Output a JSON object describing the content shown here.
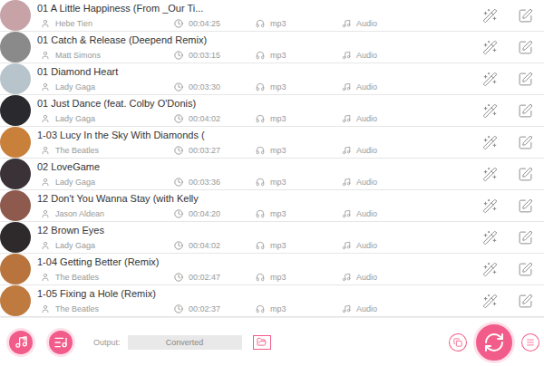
{
  "tracks": [
    {
      "title": "01 A Little Happiness (From _Our Ti...",
      "artist": "Hebe Tien",
      "duration": "00:04:25",
      "format": "mp3",
      "type": "Audio",
      "color": "#c7a3a8"
    },
    {
      "title": "01 Catch & Release (Deepend Remix)",
      "artist": "Matt Simons",
      "duration": "00:03:15",
      "format": "mp3",
      "type": "Audio",
      "color": "#8a8a8a"
    },
    {
      "title": "01 Diamond Heart",
      "artist": "Lady Gaga",
      "duration": "00:03:30",
      "format": "mp3",
      "type": "Audio",
      "color": "#b8c4cc"
    },
    {
      "title": "01 Just Dance (feat. Colby O'Donis)",
      "artist": "Lady Gaga",
      "duration": "00:04:02",
      "format": "mp3",
      "type": "Audio",
      "color": "#2a2a2e"
    },
    {
      "title": "1-03 Lucy In the Sky With Diamonds (",
      "artist": "The Beatles",
      "duration": "00:03:27",
      "format": "mp3",
      "type": "Audio",
      "color": "#c8803a"
    },
    {
      "title": "02 LoveGame",
      "artist": "Lady Gaga",
      "duration": "00:03:36",
      "format": "mp3",
      "type": "Audio",
      "color": "#3a3236"
    },
    {
      "title": "12 Don't You Wanna Stay (with Kelly",
      "artist": "Jason Aldean",
      "duration": "00:04:20",
      "format": "mp3",
      "type": "Audio",
      "color": "#8e5a4e"
    },
    {
      "title": "12 Brown Eyes",
      "artist": "Lady Gaga",
      "duration": "00:04:02",
      "format": "mp3",
      "type": "Audio",
      "color": "#2e2a2c"
    },
    {
      "title": "1-04 Getting Better (Remix)",
      "artist": "The Beatles",
      "duration": "00:02:47",
      "format": "mp3",
      "type": "Audio",
      "color": "#b8743c"
    },
    {
      "title": "1-05 Fixing a Hole (Remix)",
      "artist": "The Beatles",
      "duration": "00:02:37",
      "format": "mp3",
      "type": "Audio",
      "color": "#bf7a40"
    }
  ],
  "output": {
    "label": "Output:",
    "value": "Converted"
  }
}
